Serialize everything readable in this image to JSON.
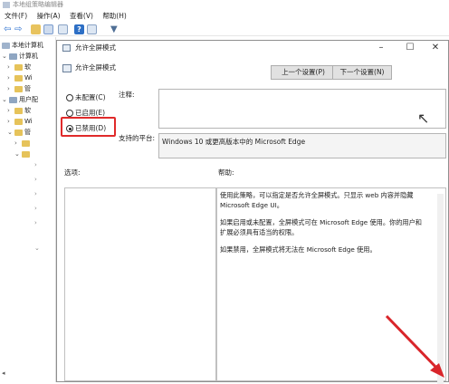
{
  "window": {
    "title": "本地组策略编辑器"
  },
  "menu": [
    "文件(F)",
    "操作(A)",
    "查看(V)",
    "帮助(H)"
  ],
  "tree": {
    "items": [
      {
        "label": "本地计算机"
      },
      {
        "label": "计算机"
      },
      {
        "label": "软"
      },
      {
        "label": "Wi"
      },
      {
        "label": "管"
      },
      {
        "label": "用户配"
      },
      {
        "label": "软"
      },
      {
        "label": "Wi"
      },
      {
        "label": "管"
      }
    ]
  },
  "dialog": {
    "title": "允许全屏模式",
    "header": "允许全屏模式",
    "prev_button": "上一个设置(P)",
    "next_button": "下一个设置(N)",
    "options": [
      {
        "label": "未配置(C)",
        "selected": false
      },
      {
        "label": "已启用(E)",
        "selected": false
      },
      {
        "label": "已禁用(D)",
        "selected": true
      }
    ],
    "comment_label": "注释:",
    "platform_label": "支持的平台:",
    "platform_value": "Windows 10 或更高版本中的 Microsoft Edge",
    "options_label": "选项:",
    "help_label": "帮助:",
    "help_paragraphs": [
      "使用此策略，可以指定是否允许全屏模式。只显示 web 内容并隐藏 Microsoft Edge UI。",
      "如果启用或未配置，全屏模式可在 Microsoft Edge 使用。你的用户和扩展必须具有适当的权限。",
      "如果禁用，全屏模式将无法在 Microsoft Edge 使用。"
    ]
  },
  "colors": {
    "highlight_border": "#e02a2a",
    "arrow": "#d9252a"
  }
}
